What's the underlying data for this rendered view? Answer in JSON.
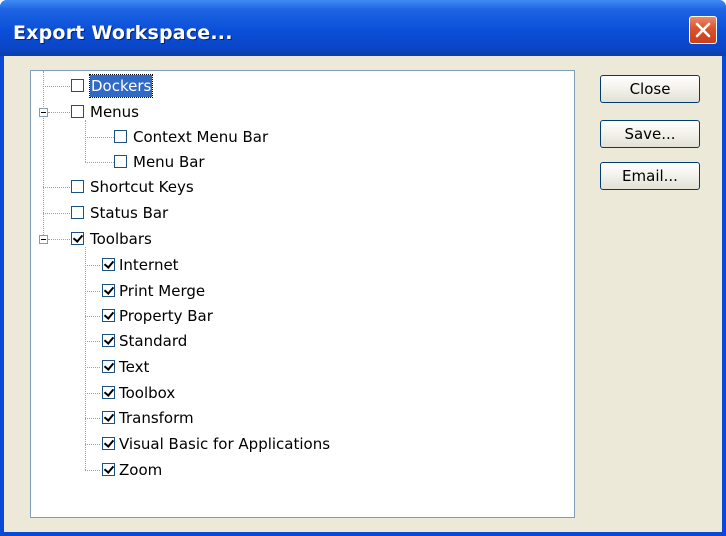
{
  "window": {
    "title": "Export Workspace..."
  },
  "buttons": {
    "close_label": "Close",
    "save_label": "Save...",
    "email_label": "Email..."
  },
  "tree": {
    "items": [
      {
        "label": "Dockers",
        "checked": false,
        "level": 0,
        "selected": true
      },
      {
        "label": "Menus",
        "checked": false,
        "level": 0,
        "expanded": true
      },
      {
        "label": "Context Menu Bar",
        "checked": false,
        "level": 1
      },
      {
        "label": "Menu Bar",
        "checked": false,
        "level": 1
      },
      {
        "label": "Shortcut Keys",
        "checked": false,
        "level": 0
      },
      {
        "label": "Status Bar",
        "checked": false,
        "level": 0
      },
      {
        "label": "Toolbars",
        "checked": true,
        "level": 0,
        "expanded": true
      },
      {
        "label": "Internet",
        "checked": true,
        "level": 1
      },
      {
        "label": "Print Merge",
        "checked": true,
        "level": 1
      },
      {
        "label": "Property Bar",
        "checked": true,
        "level": 1
      },
      {
        "label": "Standard",
        "checked": true,
        "level": 1
      },
      {
        "label": "Text",
        "checked": true,
        "level": 1
      },
      {
        "label": "Toolbox",
        "checked": true,
        "level": 1
      },
      {
        "label": "Transform",
        "checked": true,
        "level": 1
      },
      {
        "label": "Visual Basic for Applications",
        "checked": true,
        "level": 1
      },
      {
        "label": "Zoom",
        "checked": true,
        "level": 1
      }
    ]
  }
}
